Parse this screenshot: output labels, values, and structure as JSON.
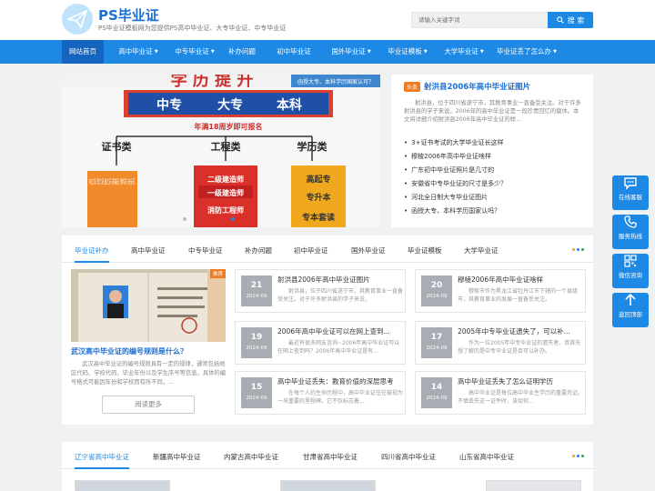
{
  "header": {
    "site_title": "PS毕业证",
    "site_subtitle": "PS毕业证模板网为您提供PS高中毕业证、大专毕业证、中专毕业证",
    "search_placeholder": "请输入关键字词",
    "search_button": "搜 索"
  },
  "nav": {
    "items": [
      {
        "label": "网站首页",
        "dropdown": false,
        "active": true
      },
      {
        "label": "高中毕业证",
        "dropdown": true
      },
      {
        "label": "中专毕业证",
        "dropdown": true
      },
      {
        "label": "补办问题",
        "dropdown": false
      },
      {
        "label": "初中毕业证",
        "dropdown": false
      },
      {
        "label": "国外毕业证",
        "dropdown": true
      },
      {
        "label": "毕业证模板",
        "dropdown": true
      },
      {
        "label": "大学毕业证",
        "dropdown": true
      },
      {
        "label": "毕业证丢了怎么办",
        "dropdown": true
      }
    ]
  },
  "hero": {
    "banner_note": "函授大专、本科学历国家认可？",
    "banner_text": {
      "top_heading": "学 历 提 升",
      "levels": [
        "中专",
        "大专",
        "本科"
      ],
      "age_note": "年满18周岁即可报名",
      "col1_title": "证书类",
      "col1_items": "电工证 焊工证 施工员 质量员 资料员 安全员",
      "col2_title": "工程类",
      "col2_items": [
        "二级建造师",
        "一级建造师",
        "消防工程师"
      ],
      "col3_title": "学历类",
      "col3_items": [
        "高起专",
        "专升本",
        "专本套读"
      ]
    },
    "featured_tag": "头条",
    "featured_title": "射洪县2006年高中毕业证图片",
    "featured_desc": "射洪县，位于四川省遂宁市，其教育事业一直备受关注。对于许多射洪县的学子来说，2006年的高中毕业证是一段珍贵回忆的载体。本文将详细介绍射洪县2006年高中毕业证的样...",
    "list": [
      "3+证书考试的大学毕业证长这样",
      "穆棱2006年高中毕业证啥样",
      "广东初中毕业证照片是几寸的",
      "安徽省中专毕业证的尺寸是多少？",
      "河北全日制大专毕业证图片",
      "函授大专、本科学历国家认吗？"
    ]
  },
  "panel": {
    "tabs": [
      "毕业证补办",
      "高中毕业证",
      "中专毕业证",
      "补办问题",
      "初中毕业证",
      "国外毕业证",
      "毕业证模板",
      "大学毕业证"
    ],
    "more_dot_colors": [
      "#f0a020",
      "#1e88e5",
      "#43a047"
    ],
    "featured": {
      "badge": "推荐",
      "title": "武汉高中毕业证的编号规则是什么？",
      "desc": "武汉高中毕业证的编号规则具有一定的规律，通常包括地区代码、学校代码、毕业年份以及学生序号等信息。具体的编号格式可能因年份和学校而有所不同，...",
      "more_button": "阅读更多"
    },
    "cards": [
      {
        "day": "21",
        "month": "2024-09",
        "title": "射洪县2006年高中毕业证图片",
        "desc": "射洪县，位于四川省遂宁市，其教育事业一直备受关注。对于许多射洪县的学子来说，"
      },
      {
        "day": "20",
        "month": "2024-09",
        "title": "穆棱2006年高中毕业证啥样",
        "desc": "穆棱市作为黑龙江省牡丹江市下辖的一个县级市，其教育事业的发展一直备受关注。"
      },
      {
        "day": "19",
        "month": "2024-09",
        "title": "2006年高中毕业证可以在网上查到...",
        "desc": "最近有很多网友咨询~2006年高中毕业证可以在网上查到吗？2006年高中毕业证是有..."
      },
      {
        "day": "17",
        "month": "2024-09",
        "title": "2005年中专毕业证遗失了，可以补...",
        "desc": "作为一位2005年中专毕业证的遗失者，我首先想了解的是中专毕业证是否可以补办。"
      },
      {
        "day": "15",
        "month": "2024-09",
        "title": "高中毕业证丢失：教育价值的深层思考",
        "desc": "在每个人的生命历程中，高中毕业证往往被视为一块重要的里程碑。它不仅标志着..."
      },
      {
        "day": "14",
        "month": "2024-09",
        "title": "高中毕业证丢失了怎么证明学历",
        "desc": "高中毕业证是每位高中毕业生学历的重要凭证。不慎丢失这一证件时，该如何..."
      }
    ]
  },
  "panel2": {
    "tabs": [
      "辽宁省高中毕业证",
      "新疆高中毕业证",
      "内蒙古高中毕业证",
      "甘肃省高中毕业证",
      "四川省高中毕业证",
      "山东省高中毕业证"
    ]
  },
  "side_tools": [
    {
      "label": "在线客服",
      "icon": "chat-icon"
    },
    {
      "label": "服务热线",
      "icon": "phone-icon"
    },
    {
      "label": "微信咨询",
      "icon": "qrcode-icon"
    },
    {
      "label": "返回顶部",
      "icon": "arrow-up-icon"
    }
  ],
  "colors": {
    "primary": "#1e88e5",
    "nav_active": "#1565c0",
    "accent_orange": "#f07c22",
    "date_badge": "#a8adb3"
  }
}
